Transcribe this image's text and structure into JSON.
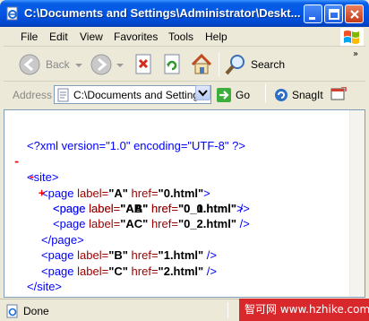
{
  "window": {
    "title": "C:\\Documents and Settings\\Administrator\\Deskt..."
  },
  "menu": [
    "File",
    "Edit",
    "View",
    "Favorites",
    "Tools",
    "Help"
  ],
  "toolbar": {
    "back_label": "Back",
    "search_label": "Search"
  },
  "address": {
    "label": "Address",
    "value": "C:\\Documents and Settings",
    "go_label": "Go",
    "snagit_label": "SnagIt"
  },
  "xml": {
    "declaration": "<?xml version=\"1.0\" encoding=\"UTF-8\" ?>",
    "toggles": {
      "minus": "-",
      "plus": "+"
    },
    "root_open": "<site>",
    "root_close": "</site>",
    "page_open": "<page",
    "page_close": "</page>",
    "label_attr": "label=",
    "href_attr": "href=",
    "gt": ">",
    "selfclose": " />",
    "pages": [
      {
        "label": "\"A\"",
        "href": "\"0.html\""
      },
      {
        "label": "\"AA\"",
        "href": "\"0_0.html\""
      },
      {
        "label": "\"AB\"",
        "href": "\"0_1.html\""
      },
      {
        "label": "\"AC\"",
        "href": "\"0_2.html\""
      },
      {
        "label": "\"B\"",
        "href": "\"1.html\""
      },
      {
        "label": "\"C\"",
        "href": "\"2.html\""
      }
    ]
  },
  "status": {
    "text": "Done"
  },
  "watermark": "智可网 www.hzhike.com",
  "colors": {
    "tag": "#0000ff",
    "attr_name": "#990000",
    "toggle": "#ff0000",
    "titlebar": "#0055e5"
  }
}
